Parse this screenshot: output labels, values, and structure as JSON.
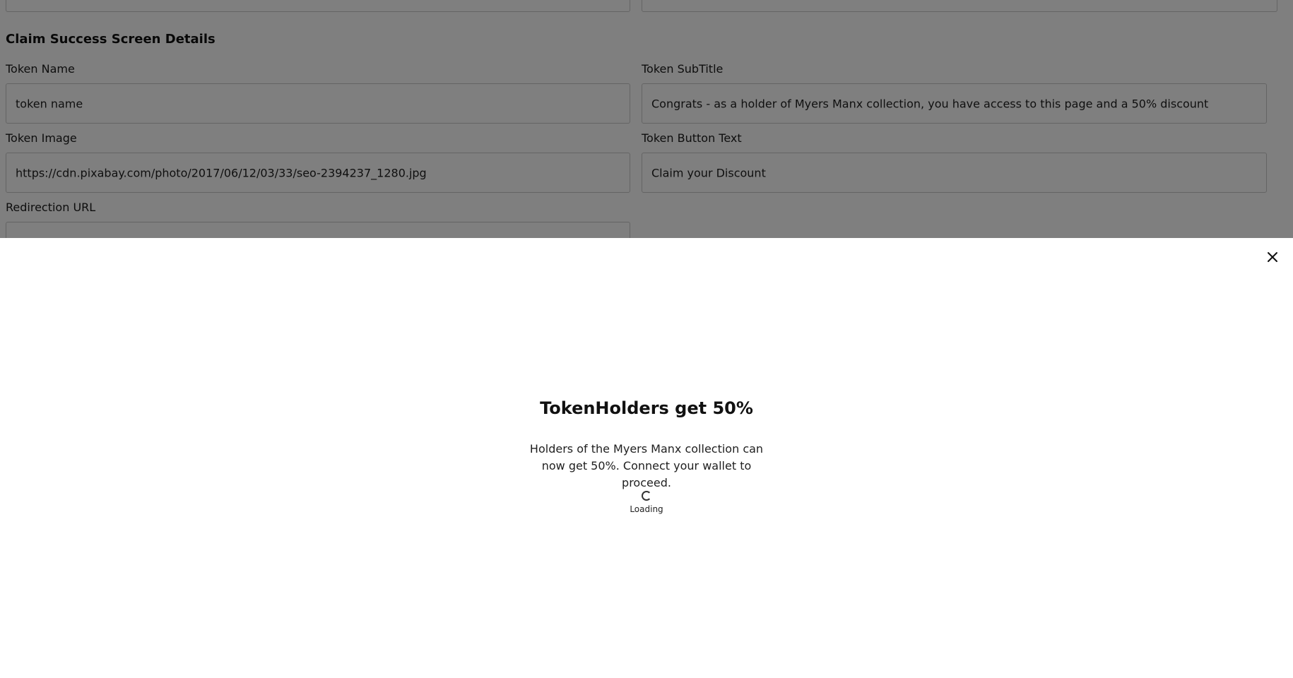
{
  "form": {
    "section_title": "Claim Success Screen Details",
    "token_name": {
      "label": "Token Name",
      "value": "token name"
    },
    "token_subtitle": {
      "label": "Token SubTitle",
      "value": "Congrats - as a holder of Myers Manx collection, you have access to this page and a 50% discount"
    },
    "token_image": {
      "label": "Token Image",
      "value": "https://cdn.pixabay.com/photo/2017/06/12/03/33/seo-2394237_1280.jpg"
    },
    "token_button_text": {
      "label": "Token Button Text",
      "value": "Claim your Discount"
    },
    "redirection_url": {
      "label": "Redirection URL",
      "value": ""
    }
  },
  "modal": {
    "close_icon": "close-icon",
    "title": "TokenHolders get 50%",
    "description": "Holders of the Myers Manx collection can now get 50%. Connect your wallet to proceed.",
    "loading_label": "Loading"
  },
  "colors": {
    "overlay": "#000000",
    "modal_bg": "#ffffff",
    "text": "#111111"
  }
}
